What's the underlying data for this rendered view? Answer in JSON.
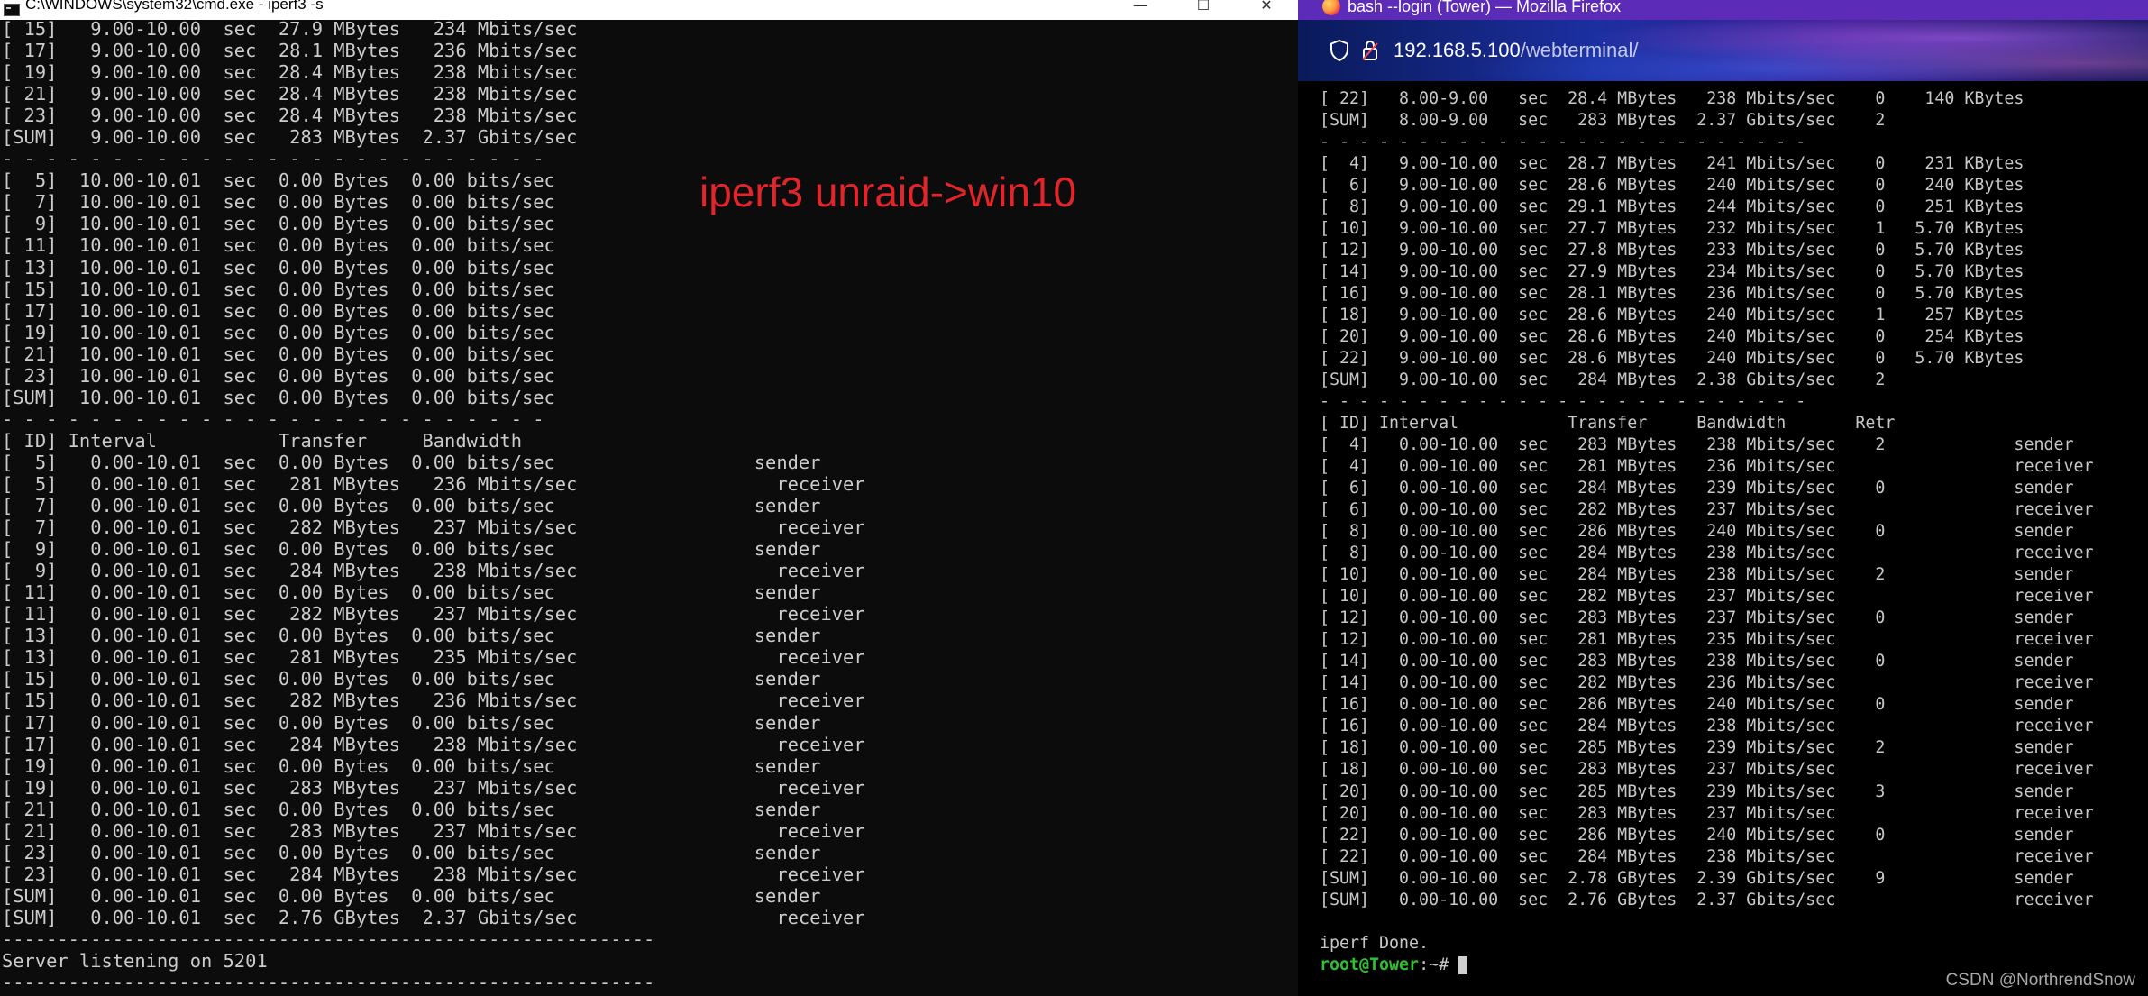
{
  "cmd_window": {
    "title": "C:\\WINDOWS\\system32\\cmd.exe - iperf3 -s",
    "controls": {
      "minimize": "—",
      "maximize": "☐",
      "close": "✕"
    },
    "lines": [
      "[ 15]   9.00-10.00  sec  27.9 MBytes   234 Mbits/sec",
      "[ 17]   9.00-10.00  sec  28.1 MBytes   236 Mbits/sec",
      "[ 19]   9.00-10.00  sec  28.4 MBytes   238 Mbits/sec",
      "[ 21]   9.00-10.00  sec  28.4 MBytes   238 Mbits/sec",
      "[ 23]   9.00-10.00  sec  28.4 MBytes   238 Mbits/sec",
      "[SUM]   9.00-10.00  sec   283 MBytes  2.37 Gbits/sec",
      "- - - - - - - - - - - - - - - - - - - - - - - - -",
      "[  5]  10.00-10.01  sec  0.00 Bytes  0.00 bits/sec",
      "[  7]  10.00-10.01  sec  0.00 Bytes  0.00 bits/sec",
      "[  9]  10.00-10.01  sec  0.00 Bytes  0.00 bits/sec",
      "[ 11]  10.00-10.01  sec  0.00 Bytes  0.00 bits/sec",
      "[ 13]  10.00-10.01  sec  0.00 Bytes  0.00 bits/sec",
      "[ 15]  10.00-10.01  sec  0.00 Bytes  0.00 bits/sec",
      "[ 17]  10.00-10.01  sec  0.00 Bytes  0.00 bits/sec",
      "[ 19]  10.00-10.01  sec  0.00 Bytes  0.00 bits/sec",
      "[ 21]  10.00-10.01  sec  0.00 Bytes  0.00 bits/sec",
      "[ 23]  10.00-10.01  sec  0.00 Bytes  0.00 bits/sec",
      "[SUM]  10.00-10.01  sec  0.00 Bytes  0.00 bits/sec",
      "- - - - - - - - - - - - - - - - - - - - - - - - -",
      "[ ID] Interval           Transfer     Bandwidth",
      "[  5]   0.00-10.01  sec  0.00 Bytes  0.00 bits/sec                  sender",
      "[  5]   0.00-10.01  sec   281 MBytes   236 Mbits/sec                  receiver",
      "[  7]   0.00-10.01  sec  0.00 Bytes  0.00 bits/sec                  sender",
      "[  7]   0.00-10.01  sec   282 MBytes   237 Mbits/sec                  receiver",
      "[  9]   0.00-10.01  sec  0.00 Bytes  0.00 bits/sec                  sender",
      "[  9]   0.00-10.01  sec   284 MBytes   238 Mbits/sec                  receiver",
      "[ 11]   0.00-10.01  sec  0.00 Bytes  0.00 bits/sec                  sender",
      "[ 11]   0.00-10.01  sec   282 MBytes   237 Mbits/sec                  receiver",
      "[ 13]   0.00-10.01  sec  0.00 Bytes  0.00 bits/sec                  sender",
      "[ 13]   0.00-10.01  sec   281 MBytes   235 Mbits/sec                  receiver",
      "[ 15]   0.00-10.01  sec  0.00 Bytes  0.00 bits/sec                  sender",
      "[ 15]   0.00-10.01  sec   282 MBytes   236 Mbits/sec                  receiver",
      "[ 17]   0.00-10.01  sec  0.00 Bytes  0.00 bits/sec                  sender",
      "[ 17]   0.00-10.01  sec   284 MBytes   238 Mbits/sec                  receiver",
      "[ 19]   0.00-10.01  sec  0.00 Bytes  0.00 bits/sec                  sender",
      "[ 19]   0.00-10.01  sec   283 MBytes   237 Mbits/sec                  receiver",
      "[ 21]   0.00-10.01  sec  0.00 Bytes  0.00 bits/sec                  sender",
      "[ 21]   0.00-10.01  sec   283 MBytes   237 Mbits/sec                  receiver",
      "[ 23]   0.00-10.01  sec  0.00 Bytes  0.00 bits/sec                  sender",
      "[ 23]   0.00-10.01  sec   284 MBytes   238 Mbits/sec                  receiver",
      "[SUM]   0.00-10.01  sec  0.00 Bytes  0.00 bits/sec                  sender",
      "[SUM]   0.00-10.01  sec  2.76 GBytes  2.37 Gbits/sec                  receiver",
      "-----------------------------------------------------------",
      "Server listening on 5201",
      "-----------------------------------------------------------"
    ]
  },
  "annotation": "iperf3 unraid->win10",
  "firefox_window": {
    "title": "bash --login (Tower) — Mozilla Firefox",
    "url_host": "192.168.5.100",
    "url_path": "/webterminal/",
    "lines": [
      "[ 22]   8.00-9.00   sec  28.4 MBytes   238 Mbits/sec    0    140 KBytes",
      "[SUM]   8.00-9.00   sec   283 MBytes  2.37 Gbits/sec    2",
      "- - - - - - - - - - - - - - - - - - - - - - - - -",
      "[  4]   9.00-10.00  sec  28.7 MBytes   241 Mbits/sec    0    231 KBytes",
      "[  6]   9.00-10.00  sec  28.6 MBytes   240 Mbits/sec    0    240 KBytes",
      "[  8]   9.00-10.00  sec  29.1 MBytes   244 Mbits/sec    0    251 KBytes",
      "[ 10]   9.00-10.00  sec  27.7 MBytes   232 Mbits/sec    1   5.70 KBytes",
      "[ 12]   9.00-10.00  sec  27.8 MBytes   233 Mbits/sec    0   5.70 KBytes",
      "[ 14]   9.00-10.00  sec  27.9 MBytes   234 Mbits/sec    0   5.70 KBytes",
      "[ 16]   9.00-10.00  sec  28.1 MBytes   236 Mbits/sec    0   5.70 KBytes",
      "[ 18]   9.00-10.00  sec  28.6 MBytes   240 Mbits/sec    1    257 KBytes",
      "[ 20]   9.00-10.00  sec  28.6 MBytes   240 Mbits/sec    0    254 KBytes",
      "[ 22]   9.00-10.00  sec  28.6 MBytes   240 Mbits/sec    0   5.70 KBytes",
      "[SUM]   9.00-10.00  sec   284 MBytes  2.38 Gbits/sec    2",
      "- - - - - - - - - - - - - - - - - - - - - - - - -",
      "[ ID] Interval           Transfer     Bandwidth       Retr",
      "[  4]   0.00-10.00  sec   283 MBytes   238 Mbits/sec    2             sender",
      "[  4]   0.00-10.00  sec   281 MBytes   236 Mbits/sec                  receiver",
      "[  6]   0.00-10.00  sec   284 MBytes   239 Mbits/sec    0             sender",
      "[  6]   0.00-10.00  sec   282 MBytes   237 Mbits/sec                  receiver",
      "[  8]   0.00-10.00  sec   286 MBytes   240 Mbits/sec    0             sender",
      "[  8]   0.00-10.00  sec   284 MBytes   238 Mbits/sec                  receiver",
      "[ 10]   0.00-10.00  sec   284 MBytes   238 Mbits/sec    2             sender",
      "[ 10]   0.00-10.00  sec   282 MBytes   237 Mbits/sec                  receiver",
      "[ 12]   0.00-10.00  sec   283 MBytes   237 Mbits/sec    0             sender",
      "[ 12]   0.00-10.00  sec   281 MBytes   235 Mbits/sec                  receiver",
      "[ 14]   0.00-10.00  sec   283 MBytes   238 Mbits/sec    0             sender",
      "[ 14]   0.00-10.00  sec   282 MBytes   236 Mbits/sec                  receiver",
      "[ 16]   0.00-10.00  sec   286 MBytes   240 Mbits/sec    0             sender",
      "[ 16]   0.00-10.00  sec   284 MBytes   238 Mbits/sec                  receiver",
      "[ 18]   0.00-10.00  sec   285 MBytes   239 Mbits/sec    2             sender",
      "[ 18]   0.00-10.00  sec   283 MBytes   237 Mbits/sec                  receiver",
      "[ 20]   0.00-10.00  sec   285 MBytes   239 Mbits/sec    3             sender",
      "[ 20]   0.00-10.00  sec   283 MBytes   237 Mbits/sec                  receiver",
      "[ 22]   0.00-10.00  sec   286 MBytes   240 Mbits/sec    0             sender",
      "[ 22]   0.00-10.00  sec   284 MBytes   238 Mbits/sec                  receiver",
      "[SUM]   0.00-10.00  sec  2.78 GBytes  2.39 Gbits/sec    9             sender",
      "[SUM]   0.00-10.00  sec  2.76 GBytes  2.37 Gbits/sec                  receiver",
      "",
      "iperf Done."
    ],
    "prompt_user": "root@Tower",
    "prompt_suffix": ":~# "
  },
  "watermark": "CSDN @NorthrendSnow",
  "colors": {
    "cmd_text": "#cccccc",
    "annotation": "#e2242b",
    "prompt_user": "#2fc22f",
    "firefox_titlebar": "#5c2bb8"
  },
  "icons": {
    "cmd": "cmd-icon",
    "firefox": "firefox-logo-icon",
    "shield": "shield-icon",
    "lock": "lock-icon"
  }
}
